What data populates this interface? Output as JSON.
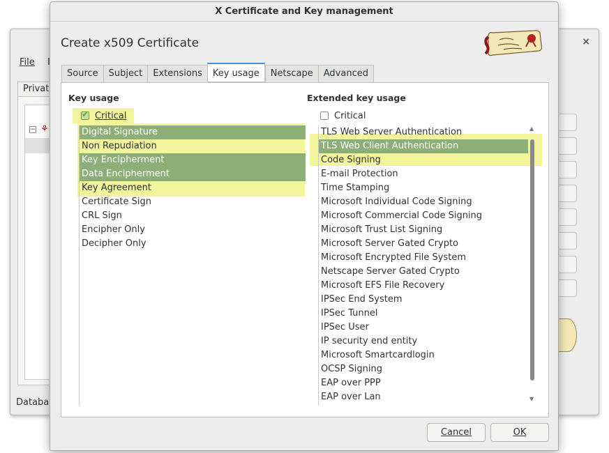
{
  "background_window": {
    "menu_file": "File",
    "menu_second": "I",
    "tab_label": "Private",
    "status_text": "Databas",
    "close_glyph": "×"
  },
  "dialog": {
    "title": "X Certificate and Key management",
    "heading": "Create x509 Certificate",
    "logo_icon": "certificate-scroll-logo"
  },
  "tabs": [
    "Source",
    "Subject",
    "Extensions",
    "Key usage",
    "Netscape",
    "Advanced"
  ],
  "active_tab": "Key usage",
  "key_usage": {
    "title": "Key usage",
    "critical_label": "Critical",
    "critical_checked": true,
    "items": [
      {
        "label": "Digital Signature",
        "selected": true
      },
      {
        "label": "Non Repudiation",
        "selected": false
      },
      {
        "label": "Key Encipherment",
        "selected": true
      },
      {
        "label": "Data Encipherment",
        "selected": true
      },
      {
        "label": "Key Agreement",
        "selected": false
      },
      {
        "label": "Certificate Sign",
        "selected": false
      },
      {
        "label": "CRL Sign",
        "selected": false
      },
      {
        "label": "Encipher Only",
        "selected": false
      },
      {
        "label": "Decipher Only",
        "selected": false
      }
    ]
  },
  "extended_key_usage": {
    "title": "Extended key usage",
    "critical_label": "Critical",
    "critical_checked": false,
    "items": [
      {
        "label": "TLS Web Server Authentication",
        "selected": false
      },
      {
        "label": "TLS Web Client Authentication",
        "selected": true
      },
      {
        "label": "Code Signing",
        "selected": false
      },
      {
        "label": "E-mail Protection",
        "selected": false
      },
      {
        "label": "Time Stamping",
        "selected": false
      },
      {
        "label": "Microsoft Individual Code Signing",
        "selected": false
      },
      {
        "label": "Microsoft Commercial Code Signing",
        "selected": false
      },
      {
        "label": "Microsoft Trust List Signing",
        "selected": false
      },
      {
        "label": "Microsoft Server Gated Crypto",
        "selected": false
      },
      {
        "label": "Microsoft Encrypted File System",
        "selected": false
      },
      {
        "label": "Netscape Server Gated Crypto",
        "selected": false
      },
      {
        "label": "Microsoft EFS File Recovery",
        "selected": false
      },
      {
        "label": "IPSec End System",
        "selected": false
      },
      {
        "label": "IPSec Tunnel",
        "selected": false
      },
      {
        "label": "IPSec User",
        "selected": false
      },
      {
        "label": "IP security end entity",
        "selected": false
      },
      {
        "label": "Microsoft Smartcardlogin",
        "selected": false
      },
      {
        "label": "OCSP Signing",
        "selected": false
      },
      {
        "label": "EAP over PPP",
        "selected": false
      },
      {
        "label": "EAP over Lan",
        "selected": false
      }
    ]
  },
  "buttons": {
    "cancel": "Cancel",
    "ok": "OK"
  },
  "colors": {
    "selection": "#8eae78",
    "highlight_marker": "#f2f59c",
    "active_tab_accent": "#4a90d9"
  }
}
